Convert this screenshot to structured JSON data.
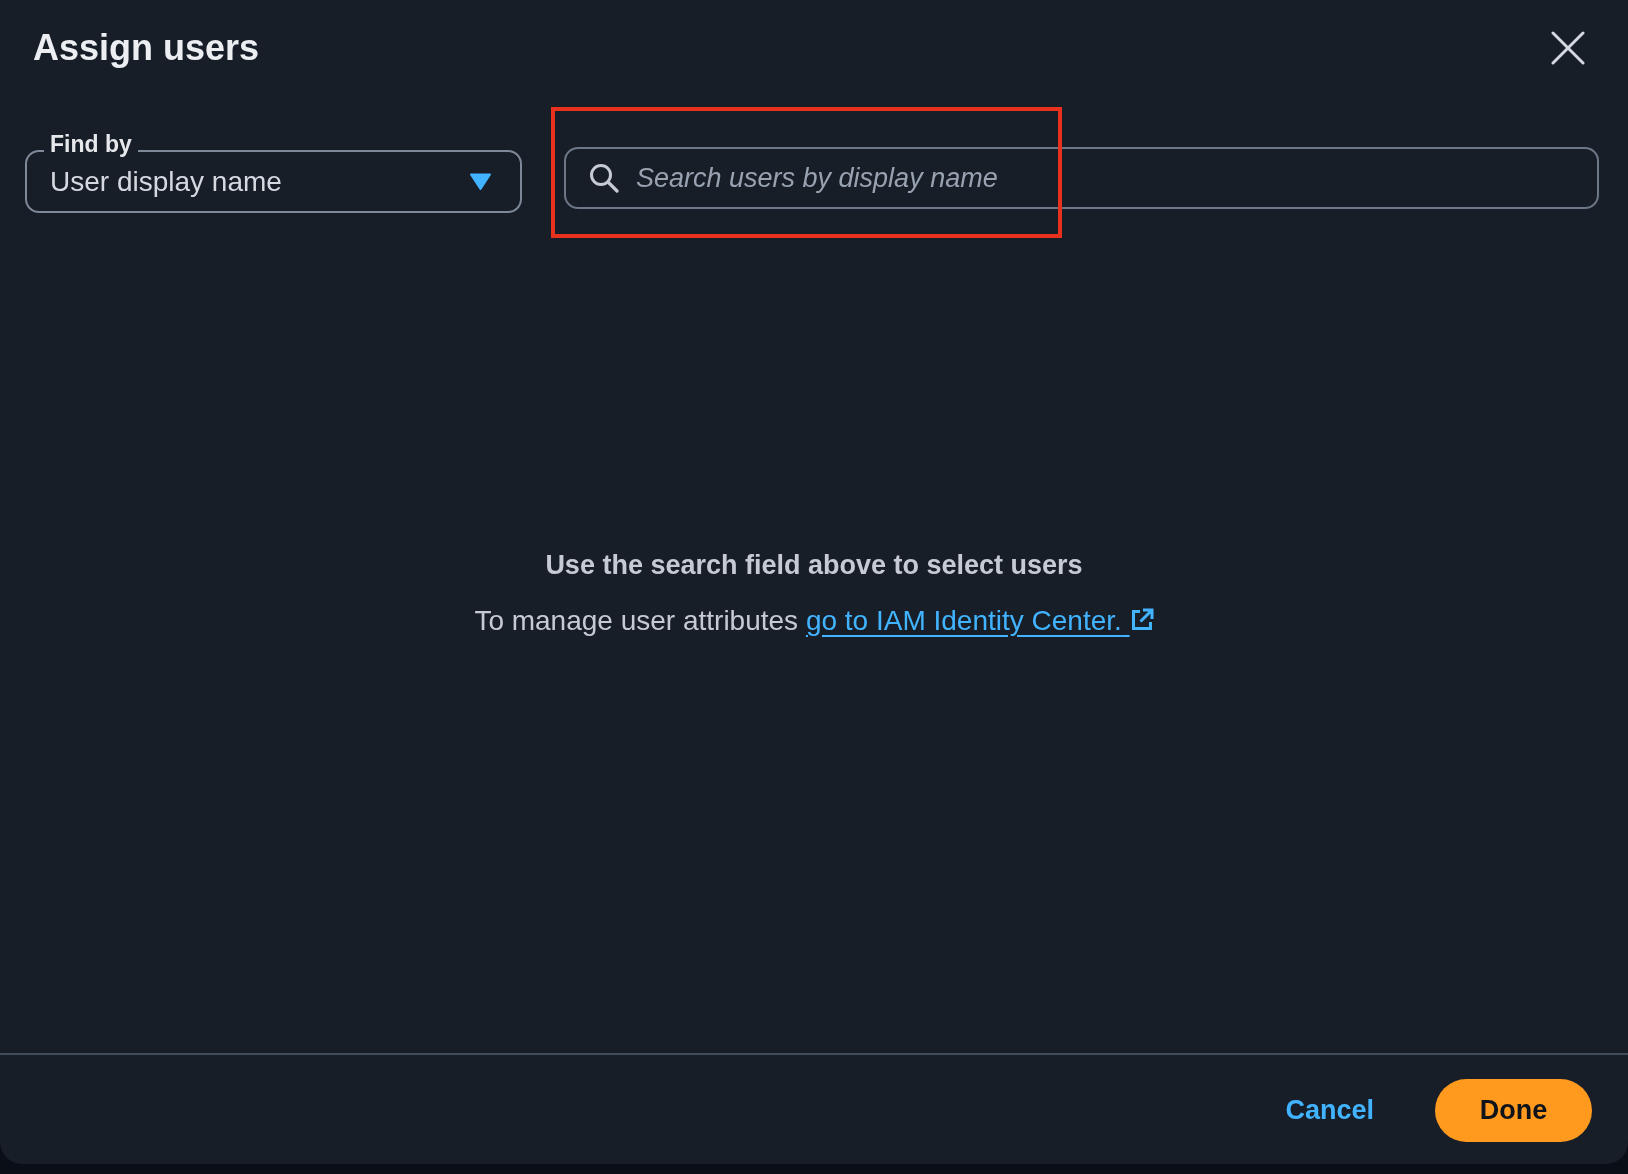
{
  "dialog": {
    "title": "Assign users"
  },
  "find_by": {
    "label": "Find by",
    "value": "User display name"
  },
  "search": {
    "placeholder": "Search users by display name",
    "highlighted": true
  },
  "empty_state": {
    "heading": "Use the search field above to select users",
    "text": "To manage user attributes",
    "link": "go to IAM Identity Center."
  },
  "footer": {
    "cancel": "Cancel",
    "done": "Done"
  }
}
